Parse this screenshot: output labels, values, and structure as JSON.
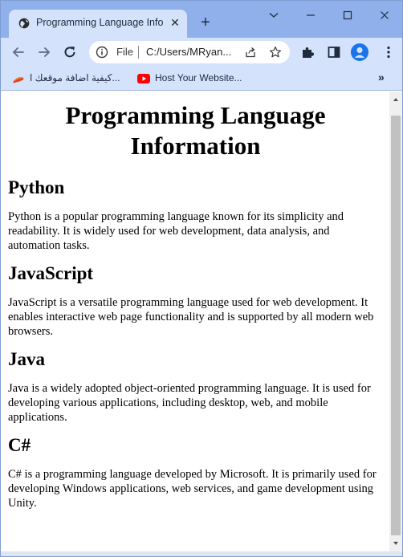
{
  "tab": {
    "title": "Programming Language Info",
    "favicon": "globe-icon"
  },
  "toolbar": {
    "scheme": "File",
    "url": "C:/Users/MRyan..."
  },
  "bookmarks": [
    {
      "label": "كيفية اضافة موقعك ا...",
      "icon": "bookmark-favicon"
    },
    {
      "label": "Host Your Website...",
      "icon": "youtube-icon"
    }
  ],
  "page": {
    "title": "Programming Language Information",
    "sections": [
      {
        "heading": "Python",
        "text": "Python is a popular programming language known for its simplicity and readability. It is widely used for web development, data analysis, and automation tasks."
      },
      {
        "heading": "JavaScript",
        "text": "JavaScript is a versatile programming language used for web development. It enables interactive web page functionality and is supported by all modern web browsers."
      },
      {
        "heading": "Java",
        "text": "Java is a widely adopted object-oriented programming language. It is used for developing various applications, including desktop, web, and mobile applications."
      },
      {
        "heading": "C#",
        "text": "C# is a programming language developed by Microsoft. It is primarily used for developing Windows applications, web services, and game development using Unity."
      }
    ]
  },
  "colors": {
    "tab_strip": "#8fb0ea",
    "toolbar": "#d4e2fb",
    "accent": "#1a73e8"
  }
}
